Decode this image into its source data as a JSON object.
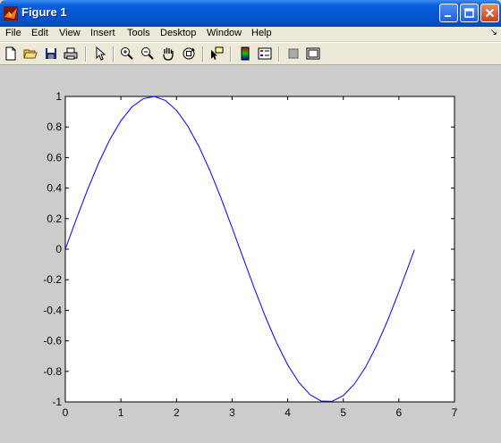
{
  "window": {
    "title": "Figure 1",
    "title_bar_color": "#0453d0",
    "buttons": [
      "minimize",
      "maximize",
      "close"
    ]
  },
  "menu": {
    "items": [
      "File",
      "Edit",
      "View",
      "Insert",
      "Tools",
      "Desktop",
      "Window",
      "Help"
    ],
    "corner_arrow": "↘"
  },
  "toolbar": {
    "icons": [
      "new-figure-icon",
      "open-file-icon",
      "save-icon",
      "print-icon",
      "edit-plot-arrow-icon",
      "zoom-in-icon",
      "zoom-out-icon",
      "pan-hand-icon",
      "rotate-3d-icon",
      "data-cursor-icon",
      "colorbar-icon",
      "legend-icon",
      "hide-plot-tools-icon",
      "show-plot-tools-icon"
    ]
  },
  "chart_data": {
    "type": "line",
    "title": "",
    "xlabel": "",
    "ylabel": "",
    "xlim": [
      0,
      7
    ],
    "ylim": [
      -1,
      1
    ],
    "xticks": [
      "0",
      "1",
      "2",
      "3",
      "4",
      "5",
      "6",
      "7"
    ],
    "yticks": [
      "1",
      "0.8",
      "0.6",
      "0.4",
      "0.2",
      "0",
      "-0.2",
      "-0.4",
      "-0.6",
      "-0.8",
      "-1"
    ],
    "grid": false,
    "series": [
      {
        "color": "#0000ff",
        "x": [
          0,
          0.2,
          0.4,
          0.6,
          0.8,
          1.0,
          1.2,
          1.4,
          1.6,
          1.8,
          2.0,
          2.2,
          2.4,
          2.6,
          2.8,
          3.0,
          3.2,
          3.4,
          3.6,
          3.8,
          4.0,
          4.2,
          4.4,
          4.6,
          4.8,
          5.0,
          5.2,
          5.4,
          5.6,
          5.8,
          6.0,
          6.2,
          6.28
        ],
        "y": [
          0,
          0.199,
          0.389,
          0.565,
          0.717,
          0.841,
          0.932,
          0.985,
          1.0,
          0.974,
          0.909,
          0.808,
          0.675,
          0.516,
          0.335,
          0.141,
          -0.058,
          -0.256,
          -0.443,
          -0.612,
          -0.757,
          -0.872,
          -0.952,
          -0.994,
          -0.996,
          -0.959,
          -0.883,
          -0.773,
          -0.631,
          -0.465,
          -0.279,
          -0.083,
          -0.003
        ]
      }
    ]
  }
}
